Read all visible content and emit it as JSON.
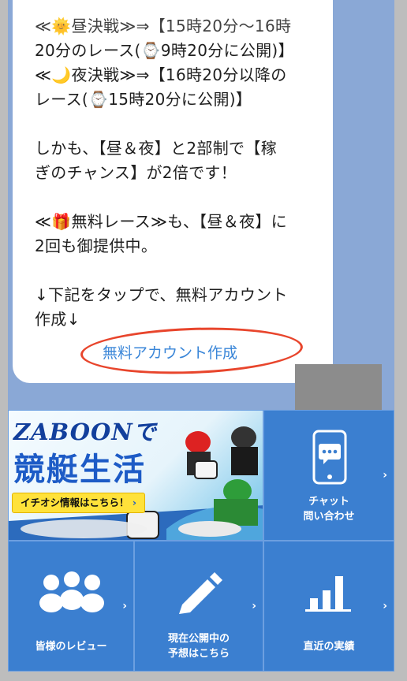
{
  "message": {
    "line1": "≪🌞昼決戦≫⇒【15時20分～16時",
    "line2": "20分のレース(⌚9時20分に公開)】",
    "line3": "≪🌙夜決戦≫⇒【16時20分以降の",
    "line4": "レース(⌚15時20分に公開)】",
    "para2a": "しかも、【昼＆夜】と2部制で【稼",
    "para2b": "ぎのチャンス】が2倍です！",
    "para3a": "≪🎁無料レース≫も、【昼＆夜】に",
    "para3b": "2回も御提供中。",
    "para4a": "↓下記をタップで、無料アカウント",
    "para4b": "作成↓",
    "link": "無料アカウント作成"
  },
  "banner": {
    "logo": "ZABOONで",
    "title": "競艇生活",
    "cta": "イチオシ情報はこちら！",
    "cta_chevron": "›"
  },
  "menu": {
    "chat": "チャット\n問い合わせ",
    "reviews": "皆様のレビュー",
    "predictions_line1": "現在公開中の",
    "predictions_line2": "予想はこちら",
    "results": "直近の実績",
    "arrow": "›"
  },
  "colors": {
    "tile_blue": "#3b7fd0",
    "background_blue": "#8aa8d6",
    "link_blue": "#3a86d8",
    "annotation_red": "#e8452c"
  },
  "icons": {
    "chat": "chat-icon",
    "reviews": "people-icon",
    "predictions": "pencil-icon",
    "results": "bar-chart-icon"
  }
}
